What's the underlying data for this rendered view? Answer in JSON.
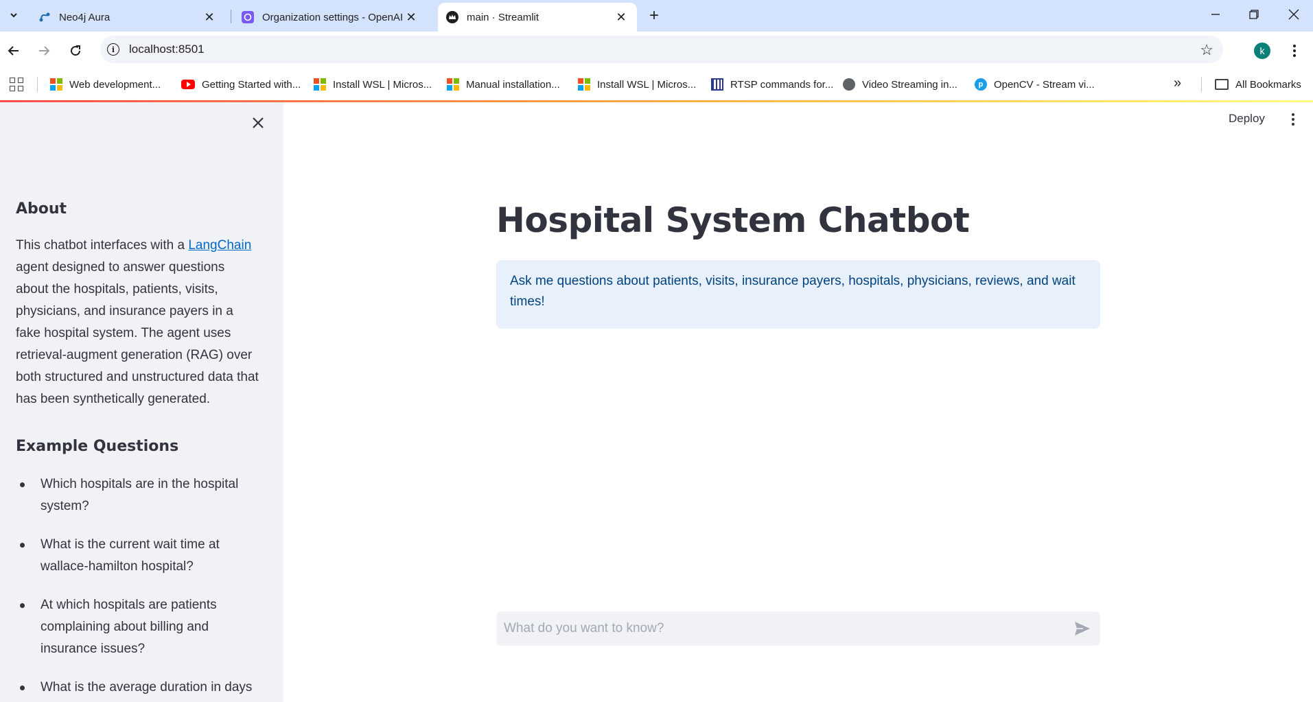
{
  "browser": {
    "tabs": [
      {
        "title": "Neo4j Aura",
        "active": false
      },
      {
        "title": "Organization settings - OpenAI",
        "active": false
      },
      {
        "title": "main · Streamlit",
        "active": true
      }
    ],
    "address": "localhost:8501",
    "profile_initial": "k",
    "bookmarks": [
      {
        "label": "Web development...",
        "icon": "microsoft-icon"
      },
      {
        "label": "Getting Started with...",
        "icon": "youtube-icon"
      },
      {
        "label": "Install WSL | Micros...",
        "icon": "microsoft-icon"
      },
      {
        "label": "Manual installation...",
        "icon": "microsoft-icon"
      },
      {
        "label": "Install WSL | Micros...",
        "icon": "microsoft-icon"
      },
      {
        "label": "RTSP commands for...",
        "icon": "grid-icon"
      },
      {
        "label": "Video Streaming in...",
        "icon": "globe-icon"
      },
      {
        "label": "OpenCV - Stream vi...",
        "icon": "pyimagesearch-icon"
      }
    ],
    "all_bookmarks_label": "All Bookmarks"
  },
  "sidebar": {
    "about_heading": "About",
    "about_text_before_link": "This chatbot interfaces with a ",
    "about_link_text": "LangChain",
    "about_text_after_link": " agent designed to answer questions about the hospitals, patients, visits, physicians, and insurance payers in a fake hospital system. The agent uses retrieval-augment generation (RAG) over both structured and unstructured data that has been synthetically generated.",
    "examples_heading": "Example Questions",
    "examples": [
      "Which hospitals are in the hospital system?",
      "What is the current wait time at wallace-hamilton hospital?",
      "At which hospitals are patients complaining about billing and insurance issues?",
      "What is the average duration in days"
    ]
  },
  "main": {
    "deploy_label": "Deploy",
    "title": "Hospital System Chatbot",
    "info": "Ask me questions about patients, visits, insurance payers, hospitals, physicians, reviews, and wait times!",
    "chat_placeholder": "What do you want to know?"
  },
  "colors": {
    "sidebar_bg": "#f0f2f6",
    "info_bg": "#e8f1fb",
    "info_text": "#004280",
    "link": "#0068c9",
    "text": "#31333f"
  }
}
